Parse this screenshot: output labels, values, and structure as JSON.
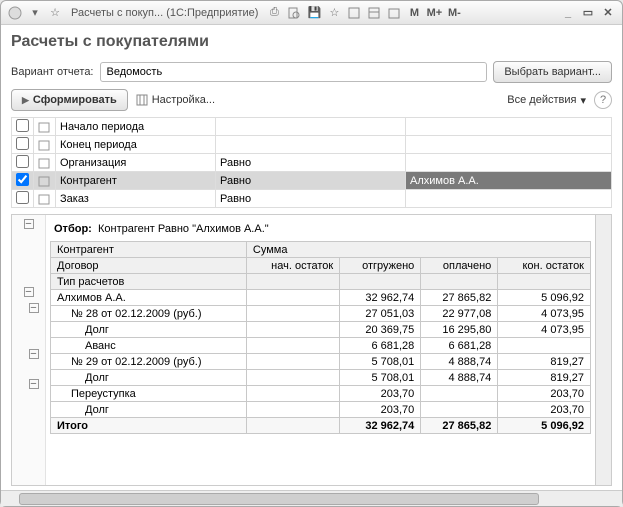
{
  "titlebar": {
    "title": "Расчеты с покуп... (1С:Предприятие)",
    "mem_labels": [
      "M",
      "M+",
      "M-"
    ]
  },
  "page_title": "Расчеты с покупателями",
  "variant": {
    "label": "Вариант отчета:",
    "value": "Ведомость",
    "choose_btn": "Выбрать вариант..."
  },
  "toolbar": {
    "run": "Сформировать",
    "settings": "Настройка...",
    "all_actions": "Все действия",
    "help": "?"
  },
  "filters": [
    {
      "checked": false,
      "name": "Начало периода",
      "cond": "",
      "val": ""
    },
    {
      "checked": false,
      "name": "Конец периода",
      "cond": "",
      "val": ""
    },
    {
      "checked": false,
      "name": "Организация",
      "cond": "Равно",
      "val": ""
    },
    {
      "checked": true,
      "name": "Контрагент",
      "cond": "Равно",
      "val": "Алхимов А.А."
    },
    {
      "checked": false,
      "name": "Заказ",
      "cond": "Равно",
      "val": ""
    }
  ],
  "report": {
    "filter_label": "Отбор:",
    "filter_text": "Контрагент Равно \"Алхимов А.А.\"",
    "head": {
      "c0": "Контрагент",
      "csum": "Сумма",
      "c0b": "Договор",
      "c1": "нач. остаток",
      "c2": "отгружено",
      "c3": "оплачено",
      "c4": "кон. остаток",
      "c0c": "Тип расчетов"
    },
    "rows": [
      {
        "lvl": 0,
        "name": "Алхимов А.А.",
        "v": [
          "",
          "32 962,74",
          "27 865,82",
          "5 096,92"
        ]
      },
      {
        "lvl": 1,
        "name": "№ 28 от 02.12.2009 (руб.)",
        "v": [
          "",
          "27 051,03",
          "22 977,08",
          "4 073,95"
        ]
      },
      {
        "lvl": 2,
        "name": "Долг",
        "v": [
          "",
          "20 369,75",
          "16 295,80",
          "4 073,95"
        ]
      },
      {
        "lvl": 2,
        "name": "Аванс",
        "v": [
          "",
          "6 681,28",
          "6 681,28",
          ""
        ]
      },
      {
        "lvl": 1,
        "name": "№ 29 от 02.12.2009 (руб.)",
        "v": [
          "",
          "5 708,01",
          "4 888,74",
          "819,27"
        ]
      },
      {
        "lvl": 2,
        "name": "Долг",
        "v": [
          "",
          "5 708,01",
          "4 888,74",
          "819,27"
        ]
      },
      {
        "lvl": 1,
        "name": "Переуступка",
        "v": [
          "",
          "203,70",
          "",
          "203,70"
        ]
      },
      {
        "lvl": 2,
        "name": "Долг",
        "v": [
          "",
          "203,70",
          "",
          "203,70"
        ]
      }
    ],
    "total": {
      "name": "Итого",
      "v": [
        "",
        "32 962,74",
        "27 865,82",
        "5 096,92"
      ]
    }
  }
}
